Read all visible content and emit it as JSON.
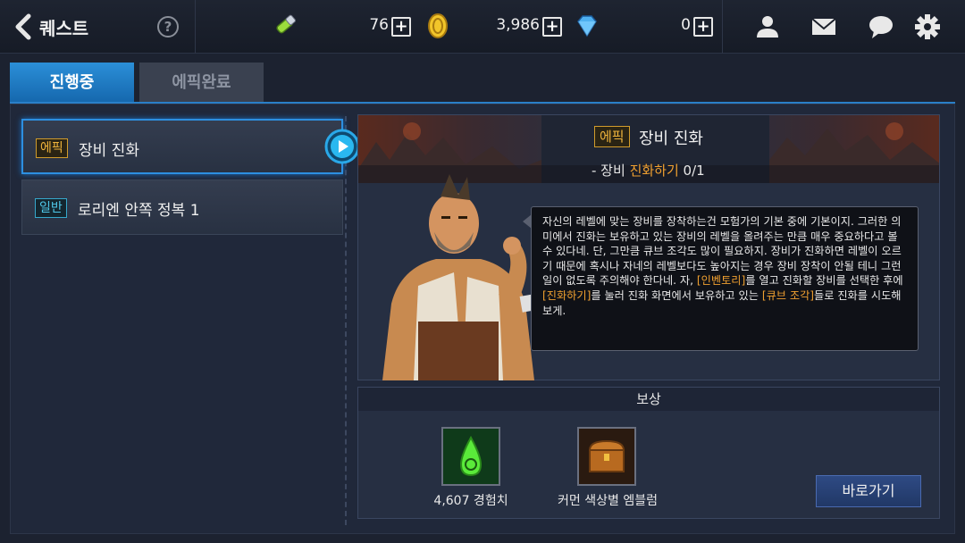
{
  "header": {
    "title": "퀘스트",
    "help_label": "?",
    "currencies": [
      {
        "icon": "stamina-icon",
        "value": "76"
      },
      {
        "icon": "gold-coin-icon",
        "value": "3,986"
      },
      {
        "icon": "gem-icon",
        "value": "0"
      }
    ],
    "plus_label": "+",
    "right_icons": [
      "friends-icon",
      "mail-icon",
      "chat-icon",
      "settings-icon"
    ]
  },
  "tabs": [
    {
      "label": "진행중",
      "active": true
    },
    {
      "label": "에픽완료",
      "active": false
    }
  ],
  "quests": [
    {
      "badge": "에픽",
      "label": "장비 진화",
      "selected": true
    },
    {
      "badge": "일반",
      "label": "로리엔 안쪽 정복 1",
      "selected": false
    }
  ],
  "detail": {
    "badge": "에픽",
    "title": "장비 진화",
    "objective_prefix": "- 장비 ",
    "objective_highlight": "진화하기",
    "objective_progress": " 0/1",
    "dialogue": {
      "part1": "자신의 레벨에 맞는 장비를 장착하는건 모험가의 기본 중에 기본이지. 그러한 의미에서 진화는 보유하고 있는 장비의 레벨을 올려주는 만큼 매우 중요하다고 볼 수 있다네. 단, 그만큼 큐브 조각도 많이 필요하지. 장비가 진화하면 레벨이 오르기 때문에 혹시나 자네의 레벨보다도 높아지는 경우 장비 장착이 안될 테니 그런일이 없도록 주의해야 한다네. 자, ",
      "hl1": "[인벤토리]",
      "part2": "를 열고 진화할 장비를 선택한 후에 ",
      "hl2": "[진화하기]",
      "part3": "를 눌러 진화 화면에서 보유하고 있는 ",
      "hl3": "[큐브 조각]",
      "part4": "들로 진화를 시도해보게."
    }
  },
  "reward": {
    "header": "보상",
    "items": [
      {
        "icon": "exp-potion-icon",
        "label": "4,607 경험치"
      },
      {
        "icon": "treasure-chest-icon",
        "label": "커먼 색상별 엠블럼"
      }
    ],
    "go_button": "바로가기"
  },
  "colors": {
    "accent_blue": "#2b8fd8",
    "epic_gold": "#f0b43c",
    "normal_cyan": "#4fc7e8",
    "highlight_orange": "#f0a030"
  }
}
